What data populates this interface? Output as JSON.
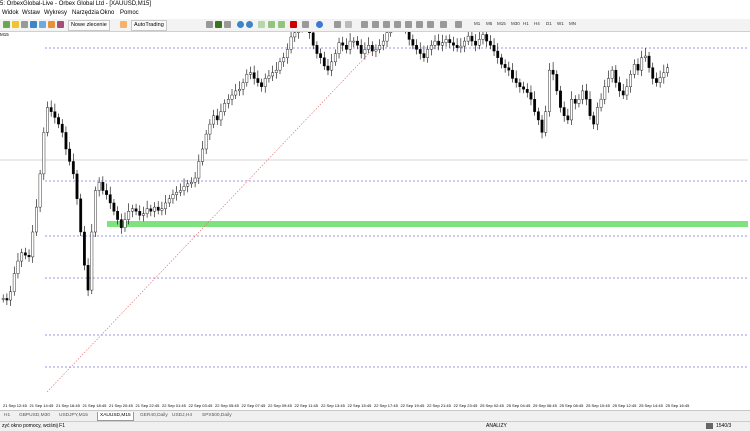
{
  "window": {
    "title": "5: OrbexGlobal-Live - Orbex Global Ltd - [XAUUSD,M15]"
  },
  "menu": {
    "items": [
      "Widok",
      "Wstaw",
      "Wykresy",
      "Narzędzia",
      "Okno",
      "Pomoc"
    ]
  },
  "toolbar": {
    "new_order_label": "Nowe zlecenie",
    "autotrading_label": "AutoTrading",
    "timeframes": [
      "M1",
      "M5",
      "M15",
      "M30",
      "H1",
      "H4",
      "D1",
      "W1",
      "MN"
    ]
  },
  "chart": {
    "symbol_label": "M15",
    "price_series": [
      120,
      118,
      128,
      150,
      165,
      175,
      172,
      170,
      200,
      230,
      270,
      320,
      350,
      345,
      338,
      330,
      320,
      300,
      285,
      270,
      240,
      200,
      160,
      130,
      200,
      250,
      260,
      250,
      245,
      235,
      225,
      215,
      205,
      215,
      225,
      228,
      225,
      220,
      222,
      228,
      225,
      230,
      226,
      228,
      235,
      240,
      245,
      248,
      250,
      255,
      258,
      260,
      265,
      285,
      300,
      318,
      330,
      340,
      335,
      345,
      355,
      360,
      365,
      370,
      372,
      380,
      390,
      392,
      385,
      380,
      375,
      385,
      388,
      392,
      395,
      405,
      410,
      420,
      435,
      440,
      445,
      455,
      450,
      440,
      425,
      415,
      410,
      400,
      395,
      405,
      415,
      428,
      425,
      420,
      430,
      430,
      425,
      415,
      420,
      425,
      418,
      420,
      425,
      430,
      440,
      448,
      455,
      460,
      455,
      445,
      432,
      425,
      420,
      415,
      410,
      420,
      425,
      430,
      425,
      428,
      432,
      428,
      425,
      422,
      424,
      430,
      436,
      430,
      425,
      432,
      438,
      430,
      425,
      418,
      410,
      402,
      398,
      395,
      385,
      380,
      375,
      372,
      368,
      360,
      345,
      335,
      320,
      345,
      395,
      390,
      370,
      350,
      340,
      335,
      360,
      355,
      360,
      370,
      360,
      340,
      330,
      350,
      360,
      375,
      385,
      395,
      380,
      370,
      365,
      375,
      390,
      402,
      395,
      410,
      412,
      398,
      385,
      380,
      386,
      392,
      398
    ],
    "sr_levels": [
      1,
      134,
      189,
      231,
      288,
      320,
      357
    ],
    "green_zone": 191,
    "trendline": {
      "start_index": 47,
      "end_index": 375
    }
  },
  "xaxis": {
    "labels": [
      "21 Sep 12:45",
      "21 Sep 14:45",
      "21 Sep 16:45",
      "21 Sep 18:45",
      "21 Sep 20:45",
      "21 Sep 22:45",
      "22 Sep 01:45",
      "22 Sep 03:45",
      "22 Sep 05:45",
      "22 Sep 07:45",
      "22 Sep 09:45",
      "22 Sep 11:45",
      "22 Sep 13:45",
      "22 Sep 15:45",
      "22 Sep 17:45",
      "22 Sep 19:45",
      "22 Sep 21:45",
      "22 Sep 23:45",
      "25 Sep 02:45",
      "25 Sep 04:45",
      "25 Sep 06:45",
      "25 Sep 08:45",
      "25 Sep 10:45",
      "25 Sep 12:45",
      "25 Sep 14:45",
      "25 Sep 16:45"
    ]
  },
  "tabs": {
    "items": [
      {
        "label": "H1",
        "active": false
      },
      {
        "label": "GBPUSD,M30",
        "active": false
      },
      {
        "label": "USDJPY,M15",
        "active": false
      },
      {
        "label": "XAUUSD,M15",
        "active": true
      },
      {
        "label": "GER40,Daily",
        "active": false
      },
      {
        "label": "USDJ,H4",
        "active": false
      },
      {
        "label": "SPX500,Daily",
        "active": false
      }
    ]
  },
  "status": {
    "help_text": "zyć okno pomocy, wciśnij F1",
    "profile": "ANALIZY",
    "traffic": "1540/3"
  }
}
